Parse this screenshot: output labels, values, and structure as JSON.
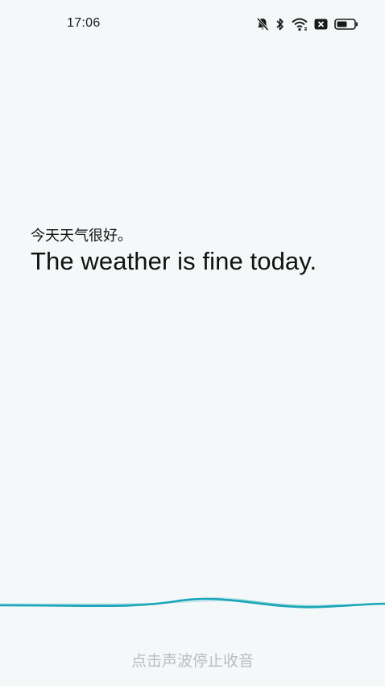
{
  "status_bar": {
    "time": "17:06",
    "icons": [
      "mute-bell-icon",
      "bluetooth-icon",
      "wifi-icon",
      "sim-disabled-icon",
      "battery-icon"
    ]
  },
  "translation": {
    "source_text": "今天天气很好。",
    "translated_text": "The weather is fine today."
  },
  "voice": {
    "stop_hint": "点击声波停止收音",
    "wave_color": "#1aa6b9"
  }
}
